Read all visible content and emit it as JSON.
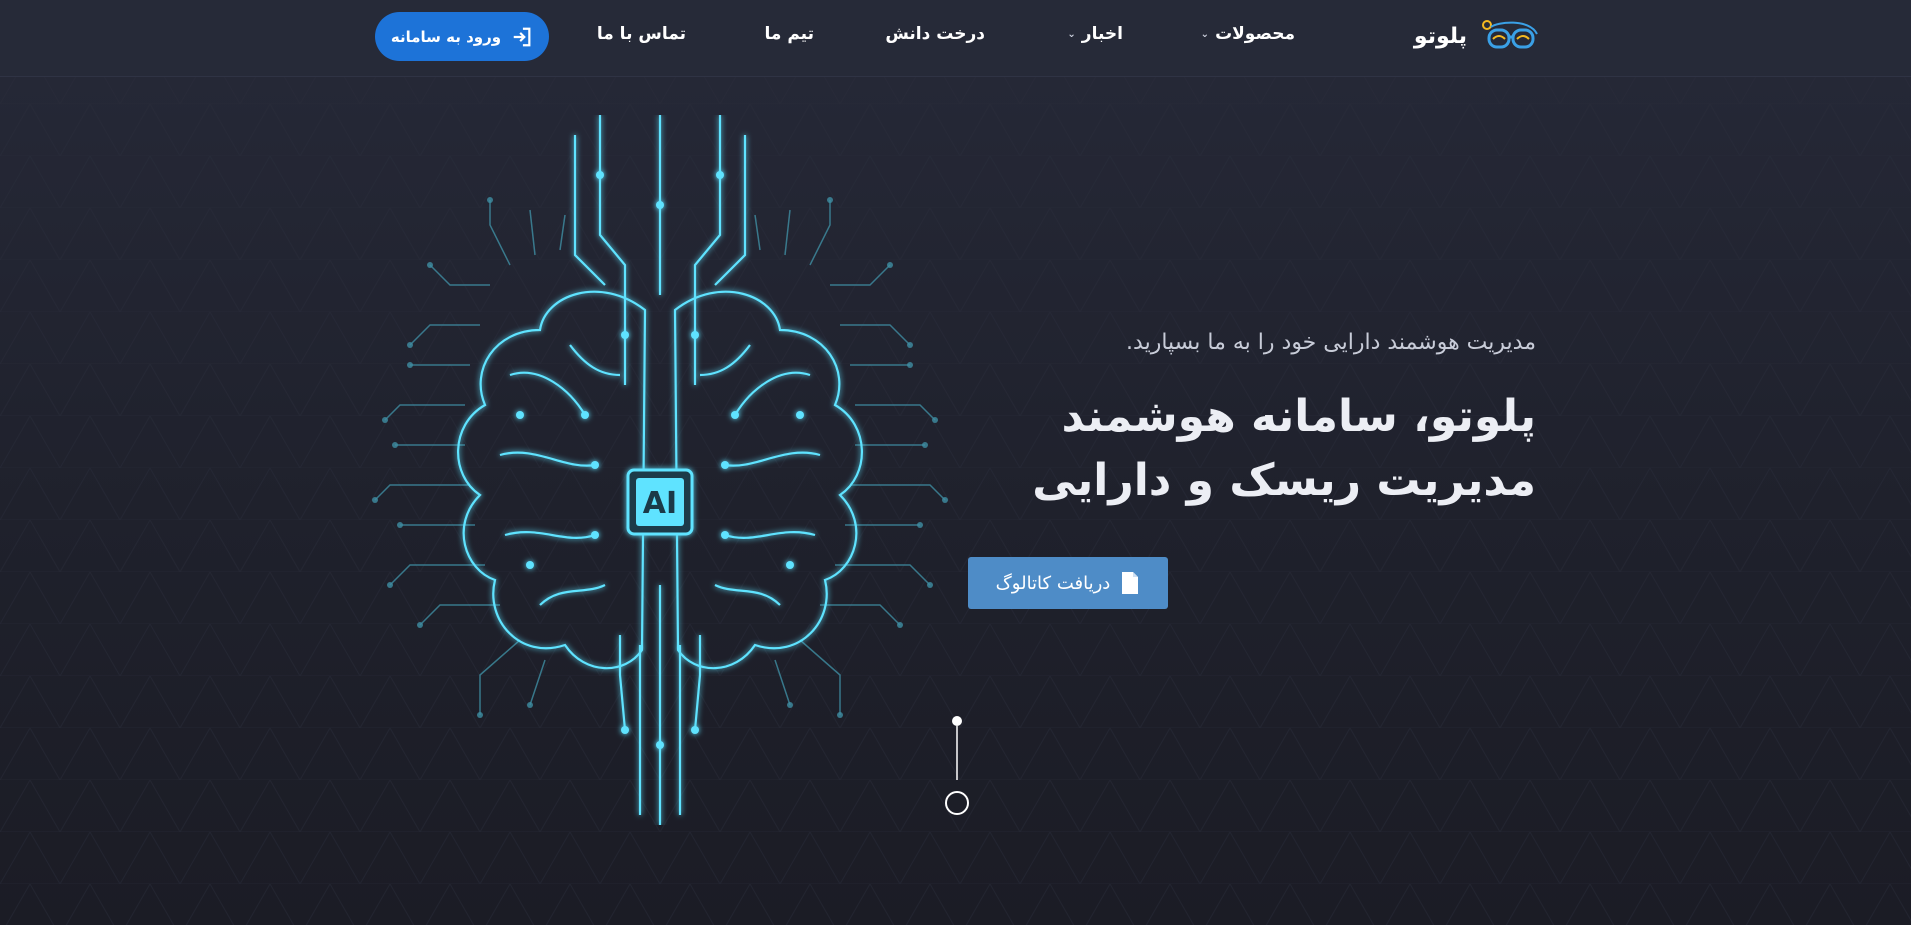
{
  "header": {
    "brand_name": "پلوتو",
    "logo_icon": "glasses-logo-icon",
    "nav": [
      {
        "label": "محصولات",
        "dropdown": true
      },
      {
        "label": "اخبار",
        "dropdown": true
      },
      {
        "label": "درخت دانش",
        "dropdown": false
      },
      {
        "label": "تیم ما",
        "dropdown": false
      },
      {
        "label": "تماس با ما",
        "dropdown": false
      }
    ],
    "dropdown_icon": "chevron-down-icon",
    "login_label": "ورود به سامانه",
    "login_icon": "sign-in-icon"
  },
  "hero": {
    "subtitle": "مدیریت هوشمند دارایی خود را به ما بسپارید.",
    "title_line1": "پلوتو، سامانه هوشمند",
    "title_line2": "مدیریت ریسک و دارایی",
    "catalog_label": "دریافت کاتالوگ",
    "catalog_icon": "file-icon",
    "illustration_label": "AI",
    "illustration_icon": "circuit-brain-icon",
    "scroll_icon": "scroll-down-indicator-icon"
  },
  "colors": {
    "background": "#20222e",
    "header": "#262a38",
    "login_button": "#1d73d8",
    "catalog_button": "#4e8cc7",
    "neon": "#5fe3ff",
    "logo_accent": "#f5b921"
  }
}
